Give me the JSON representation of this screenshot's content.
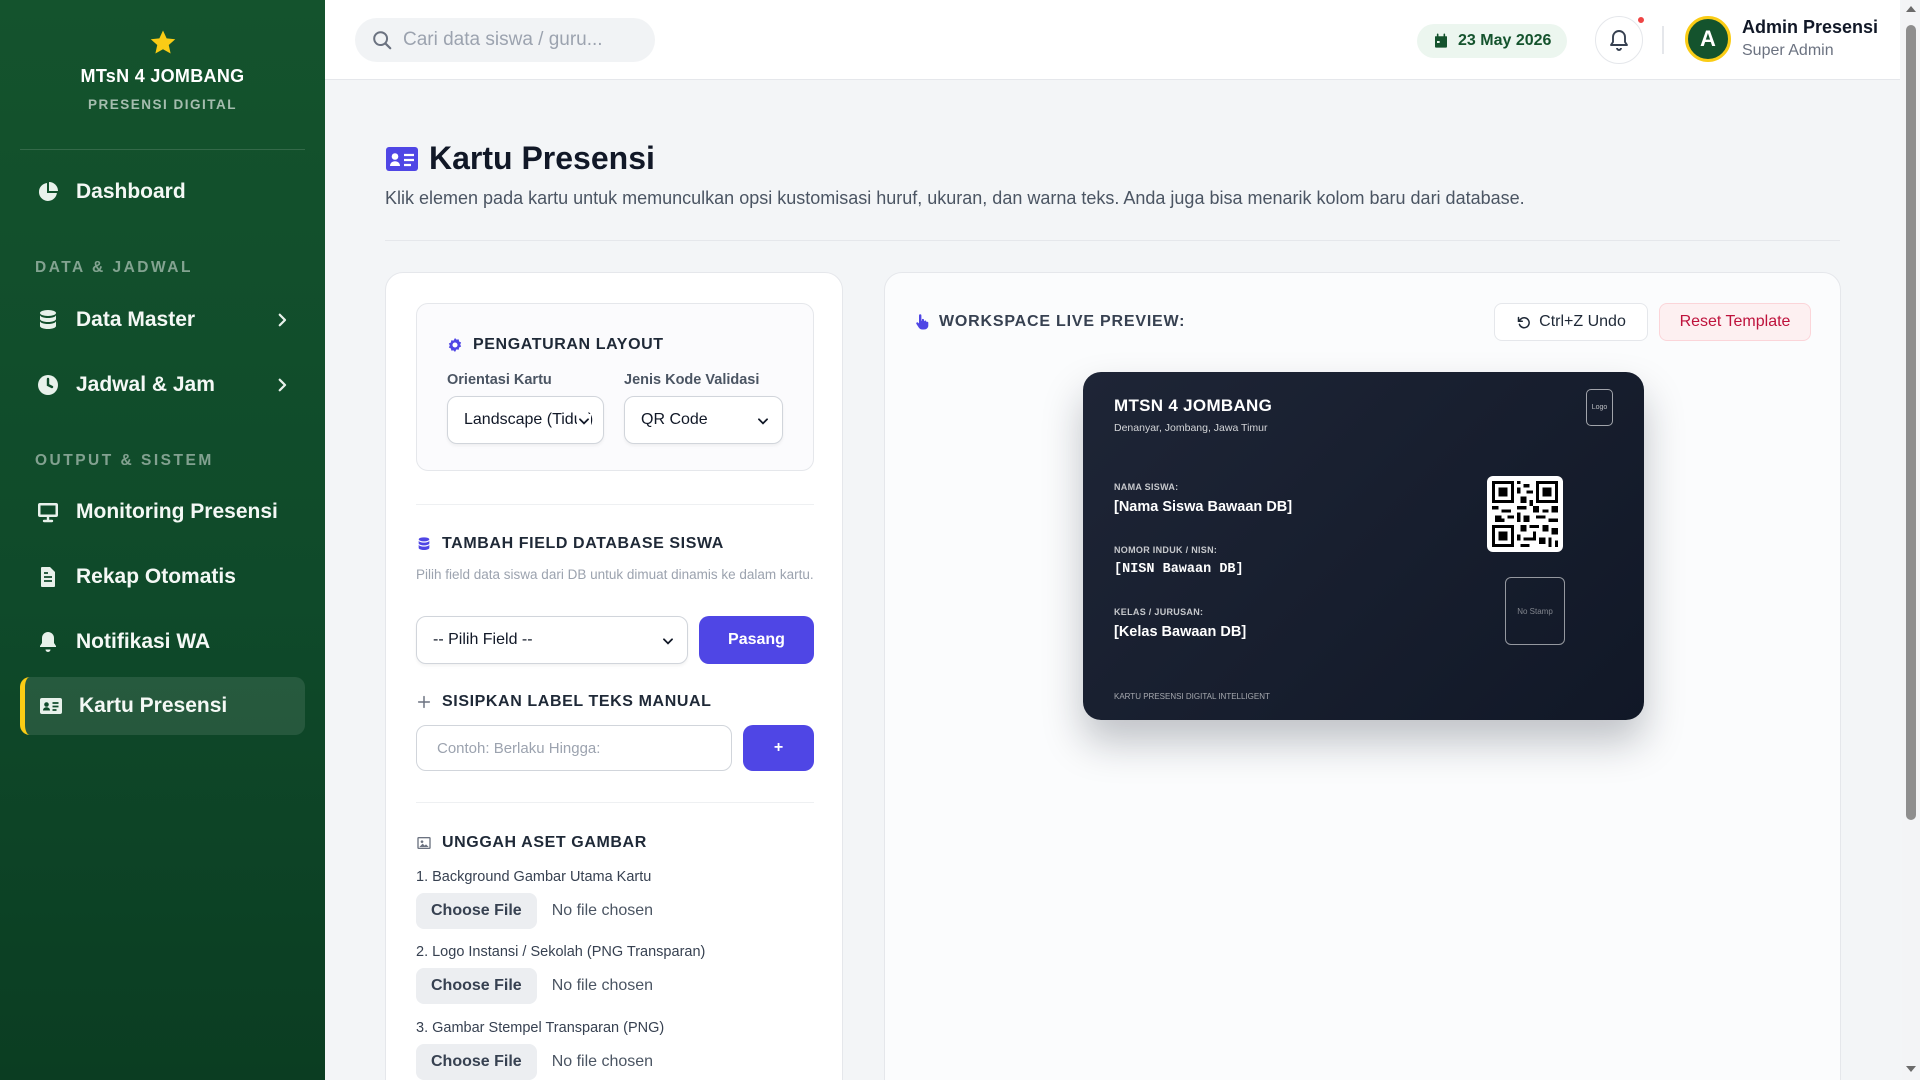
{
  "sidebar": {
    "school_name": "MTsN 4 JOMBANG",
    "app_subtitle": "PRESENSI DIGITAL",
    "accent_color": "#facc15",
    "sections": [
      "DATA & JADWAL",
      "OUTPUT & SISTEM"
    ],
    "items": [
      {
        "label": "Dashboard",
        "icon": "pie-chart-icon"
      },
      {
        "label": "Data Master",
        "icon": "database-icon",
        "has_submenu": true
      },
      {
        "label": "Jadwal & Jam",
        "icon": "clock-icon",
        "has_submenu": true
      },
      {
        "label": "Monitoring Presensi",
        "icon": "monitor-icon"
      },
      {
        "label": "Rekap Otomatis",
        "icon": "document-icon"
      },
      {
        "label": "Notifikasi WA",
        "icon": "bell-icon"
      },
      {
        "label": "Kartu Presensi",
        "icon": "id-card-icon",
        "active": true
      }
    ]
  },
  "topbar": {
    "search_placeholder": "Cari data siswa / guru...",
    "date": "23 May 2026",
    "user_initial": "A",
    "user_name": "Admin Presensi",
    "user_role": "Super Admin"
  },
  "page": {
    "title": "Kartu Presensi",
    "description": "Klik elemen pada kartu untuk memunculkan opsi kustomisasi huruf, ukuran, dan warna teks. Anda juga bisa menarik kolom baru dari database."
  },
  "layout_settings": {
    "heading": "PENGATURAN LAYOUT",
    "orientation_label": "Orientasi Kartu",
    "orientation_value": "Landscape (Tidur)",
    "code_label": "Jenis Kode Validasi",
    "code_value": "QR Code"
  },
  "db_field": {
    "heading": "TAMBAH FIELD DATABASE SISWA",
    "help": "Pilih field data siswa dari DB untuk dimuat dinamis ke dalam kartu.",
    "select_value": "-- Pilih Field --",
    "button": "Pasang"
  },
  "manual_label": {
    "heading": "SISIPKAN LABEL TEKS MANUAL",
    "placeholder": "Contoh: Berlaku Hingga:",
    "button": "+"
  },
  "assets": {
    "heading": "UNGGAH ASET GAMBAR",
    "choose_label": "Choose File",
    "none_label": "No file chosen",
    "items": [
      "1. Background Gambar Utama Kartu",
      "2. Logo Instansi / Sekolah (PNG Transparan)",
      "3. Gambar Stempel Transparan (PNG)"
    ]
  },
  "workspace": {
    "label": "WORKSPACE LIVE PREVIEW:",
    "undo_button": "Ctrl+Z Undo",
    "reset_button": "Reset Template"
  },
  "card": {
    "school": "MTSN 4 JOMBANG",
    "address": "Denanyar, Jombang, Jawa Timur",
    "logo_placeholder": "Logo",
    "name_label": "NAMA SISWA:",
    "name_value": "[Nama Siswa Bawaan DB]",
    "nisn_label": "NOMOR INDUK / NISN:",
    "nisn_value": "[NISN Bawaan DB]",
    "class_label": "KELAS / JURUSAN:",
    "class_value": "[Kelas Bawaan DB]",
    "stamp_placeholder": "No Stamp",
    "footer": "KARTU PRESENSI DIGITAL INTELLIGENT"
  }
}
